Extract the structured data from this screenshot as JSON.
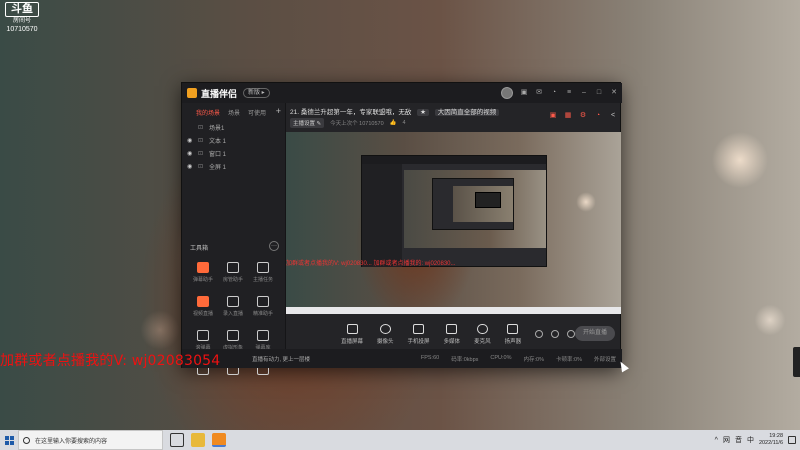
{
  "watermark": {
    "logo": "斗鱼",
    "sub": "房间号",
    "room_id": "10710570"
  },
  "app": {
    "name": "直播伴侣",
    "version_pill": "新版 ▸",
    "title_icons": [
      "gift-icon",
      "mail-icon",
      "bell-icon",
      "menu-icon",
      "minimize-icon",
      "maximize-icon",
      "close-icon"
    ]
  },
  "sidebar": {
    "tabs": [
      "我的场景",
      "场景",
      "可使用"
    ],
    "add": "+",
    "sources": [
      {
        "label": "场景1"
      },
      {
        "label": "文本 1"
      },
      {
        "label": "窗口 1"
      },
      {
        "label": "全屏 1"
      }
    ],
    "tools_title": "工具箱",
    "tools_more": "···",
    "tools": [
      {
        "label": "弹幕助手"
      },
      {
        "label": "房管助手"
      },
      {
        "label": "主播任务"
      },
      {
        "label": "视频直播"
      },
      {
        "label": "录入直播"
      },
      {
        "label": "精准助手"
      },
      {
        "label": "滚弹幕"
      },
      {
        "label": "虚拟形象"
      },
      {
        "label": "弹幕库"
      },
      {
        "label": ""
      },
      {
        "label": ""
      },
      {
        "label": ""
      }
    ]
  },
  "main": {
    "title": "21. 桑德兰升超第一年，专家联盟哦，无敌",
    "title_tag": "★",
    "title_btn": "大因简直全部的视频",
    "meta": {
      "chip": "主播设置 ✎",
      "uid": "今天上次个  10710570",
      "likes": "4"
    },
    "overlay_text_small": "加群或者点播我的V: wj020830... 加群或者点播我的: wj020830...",
    "start_button": "开始直播",
    "controls": [
      {
        "label": "直播屏幕"
      },
      {
        "label": "摄像头"
      },
      {
        "label": "手机投屏"
      },
      {
        "label": "多媒体"
      },
      {
        "label": "麦克风"
      },
      {
        "label": "扬声器"
      }
    ]
  },
  "statusbar": {
    "left": "直播有动力, 更上一层楼",
    "items": [
      "FPS:60",
      "码率:0kbps",
      "CPU:0%",
      "内存:0%",
      "卡顿率:0%",
      "外部设置"
    ]
  },
  "overlay": {
    "text": "加群或者点播我的V: wj02083054"
  },
  "taskbar": {
    "search_placeholder": "在这里输入你要搜索的内容",
    "apps": [
      "task-view-icon",
      "folder-icon",
      "live-app-icon"
    ],
    "tray_icons": [
      "^",
      "网",
      "音",
      "中"
    ],
    "time": "19:28",
    "date": "2022/11/6"
  }
}
